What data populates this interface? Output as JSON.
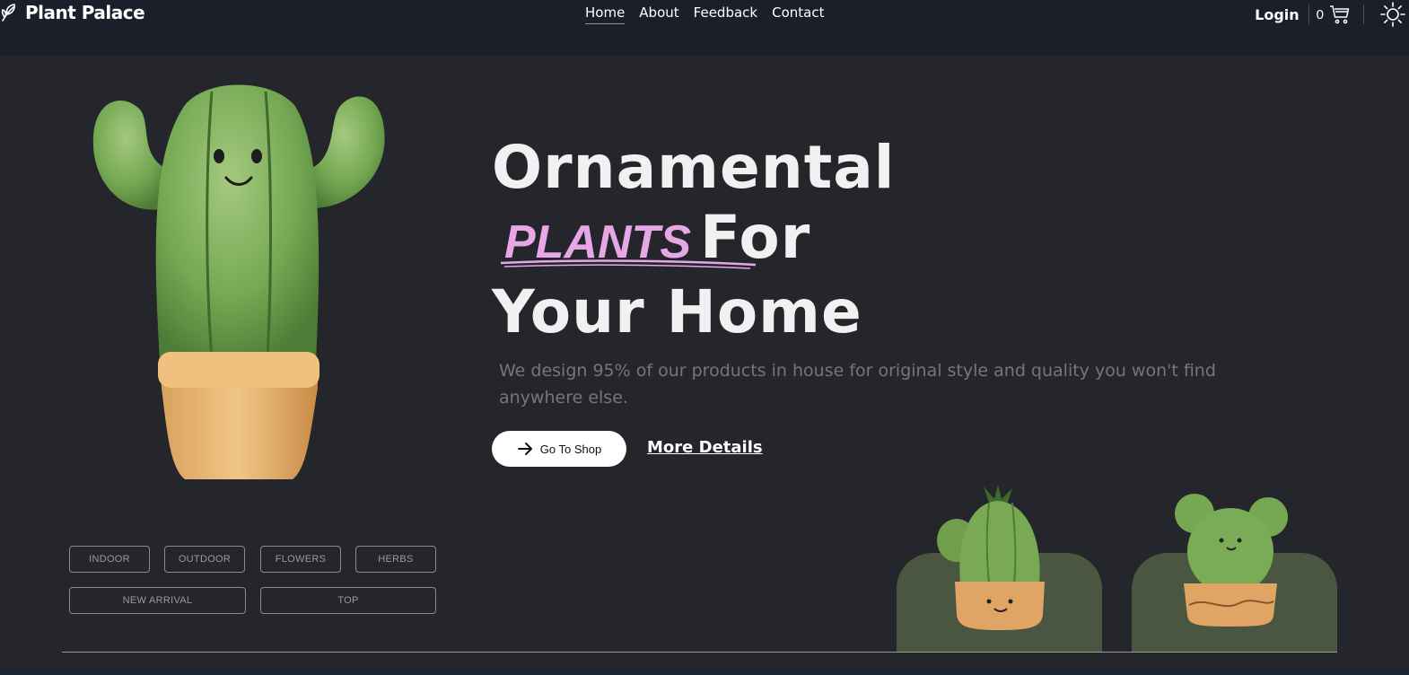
{
  "brand": {
    "name": "Plant Palace",
    "logo_icon": "leaf-icon"
  },
  "nav": {
    "links": [
      {
        "label": "Home",
        "active": true
      },
      {
        "label": "About",
        "active": false
      },
      {
        "label": "Feedback",
        "active": false
      },
      {
        "label": "Contact",
        "active": false
      }
    ],
    "login_label": "Login",
    "cart_count": "0",
    "cart_icon": "cart-icon",
    "theme_icon": "sun-icon"
  },
  "hero": {
    "line1": "Ornamental",
    "highlight": "PLANTS",
    "line2_rest": "For",
    "line3": "Your Home",
    "description": "We design 95% of our products in house for original style and quality you won't find anywhere else.",
    "shop_button": "Go To Shop",
    "more_link": "More Details"
  },
  "categories": [
    "INDOOR",
    "OUTDOOR",
    "FLOWERS",
    "HERBS",
    "NEW ARRIVAL",
    "TOP"
  ],
  "colors": {
    "background": "#25262b",
    "navbar": "#1b1f2a",
    "highlight": "#e7a6e6",
    "card": "#4b5640",
    "description": "#767676"
  }
}
